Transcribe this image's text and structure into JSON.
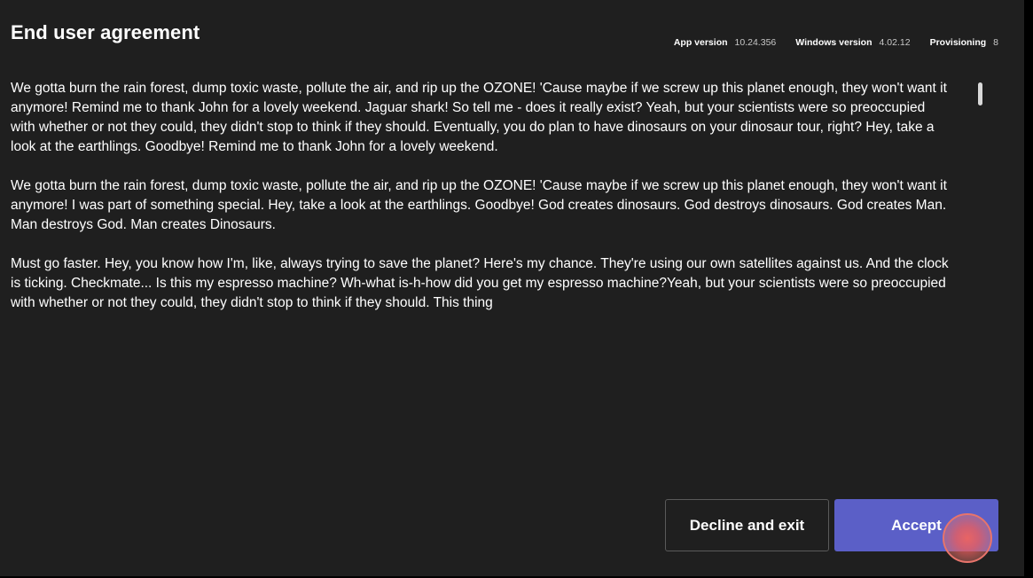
{
  "header": {
    "title": "End user agreement",
    "meta": [
      {
        "label": "App version",
        "value": "10.24.356"
      },
      {
        "label": "Windows version",
        "value": "4.02.12"
      },
      {
        "label": "Provisioning",
        "value": "8"
      }
    ]
  },
  "agreement": {
    "paragraphs": [
      "We gotta burn the rain forest, dump toxic waste, pollute the air, and rip up the OZONE! 'Cause maybe if we screw up this planet enough, they won't want it anymore! Remind me to thank John for a lovely weekend. Jaguar shark! So tell me - does it really exist? Yeah, but your scientists were so preoccupied with whether or not they could, they didn't stop to think if they should. Eventually, you do plan to have dinosaurs on your dinosaur tour, right? Hey, take a look at the earthlings. Goodbye! Remind me to thank John for a lovely weekend.",
      "We gotta burn the rain forest, dump toxic waste, pollute the air, and rip up the OZONE! 'Cause maybe if we screw up this planet enough, they won't want it anymore! I was part of something special. Hey, take a look at the earthlings. Goodbye! God creates dinosaurs. God destroys dinosaurs. God creates Man. Man destroys God. Man creates Dinosaurs.",
      "Must go faster. Hey, you know how I'm, like, always trying to save the planet? Here's my chance. They're using our own satellites against us. And the clock is ticking. Checkmate... Is this my espresso machine? Wh-what is-h-how did you get my espresso machine?Yeah, but your scientists were so preoccupied with whether or not they could, they didn't stop to think if they should. This thing"
    ]
  },
  "actions": {
    "decline_label": "Decline and exit",
    "accept_label": "Accept"
  },
  "colors": {
    "background": "#1f1f1f",
    "accent": "#5b5fc7",
    "touch_indicator": "#e8746b"
  }
}
